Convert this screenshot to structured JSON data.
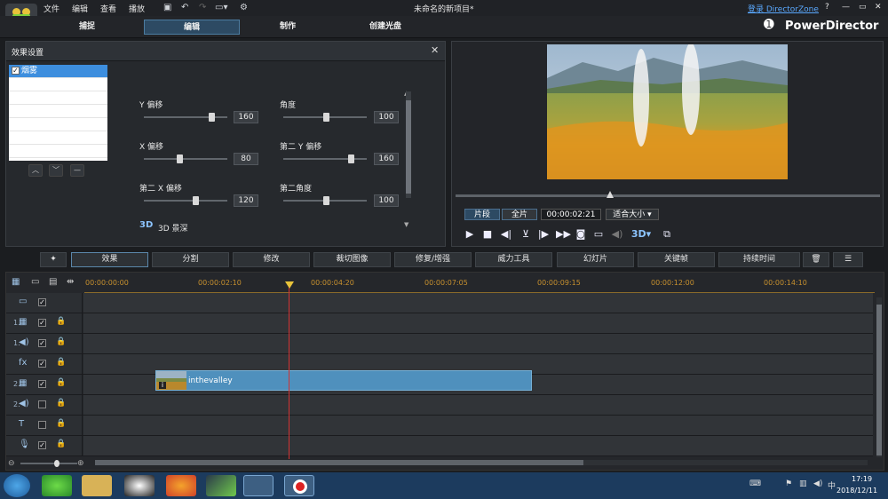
{
  "menubar": {
    "items": [
      "文件",
      "编辑",
      "查看",
      "播放"
    ],
    "window_title": "未命名的新项目*",
    "login_link": "登录 DirectorZone",
    "help": "?",
    "brand": "PowerDirector"
  },
  "modes": [
    "捕捉",
    "编辑",
    "制作",
    "创建光盘"
  ],
  "effect_panel": {
    "title": "效果设置",
    "effect_item": "烟雾",
    "params": {
      "y_offset_label": "Y 偏移",
      "y_offset_value": "160",
      "angle_label": "角度",
      "angle_value": "100",
      "x_offset_label": "X 偏移",
      "x_offset_value": "80",
      "y2_offset_label": "第二 Y 偏移",
      "y2_offset_value": "160",
      "x2_offset_label": "第二 X 偏移",
      "x2_offset_value": "120",
      "angle2_label": "第二角度",
      "angle2_value": "100",
      "depth_badge": "3D",
      "depth_label": "3D 景深"
    }
  },
  "preview": {
    "clip_tab": "片段",
    "full_tab": "全片",
    "timecode": "00:00:02:21",
    "fit_select": "适合大小"
  },
  "toolbar": {
    "buttons": [
      "效果",
      "分割",
      "修改",
      "裁切图像",
      "修复/增强",
      "威力工具",
      "幻灯片",
      "关键帧",
      "持续时间"
    ]
  },
  "timeline": {
    "ruler": [
      "00:00:00:00",
      "00:00:02:10",
      "00:00:04:20",
      "00:00:07:05",
      "00:00:09:15",
      "00:00:12:00",
      "00:00:14:10"
    ],
    "tracks": [
      {
        "num": "",
        "icon": "▭",
        "check": true,
        "lock": false
      },
      {
        "num": "1.",
        "icon": "▦",
        "check": true,
        "lock": true
      },
      {
        "num": "1.",
        "icon": "◀)",
        "check": true,
        "lock": true
      },
      {
        "num": "",
        "icon": "fx",
        "check": true,
        "lock": true
      },
      {
        "num": "2.",
        "icon": "▦",
        "check": true,
        "lock": true
      },
      {
        "num": "2.",
        "icon": "◀)",
        "check": false,
        "lock": true
      },
      {
        "num": "",
        "icon": "T",
        "check": false,
        "lock": true
      },
      {
        "num": "",
        "icon": "🎙",
        "check": true,
        "lock": true
      }
    ],
    "clip_name": "inthevalley"
  },
  "taskbar": {
    "time": "17:19",
    "date": "2018/12/11"
  },
  "colors": {
    "accent": "#2d4a63",
    "clip": "#4f90bd",
    "playhead": "#d23333",
    "ruler_text": "#c7902e"
  }
}
